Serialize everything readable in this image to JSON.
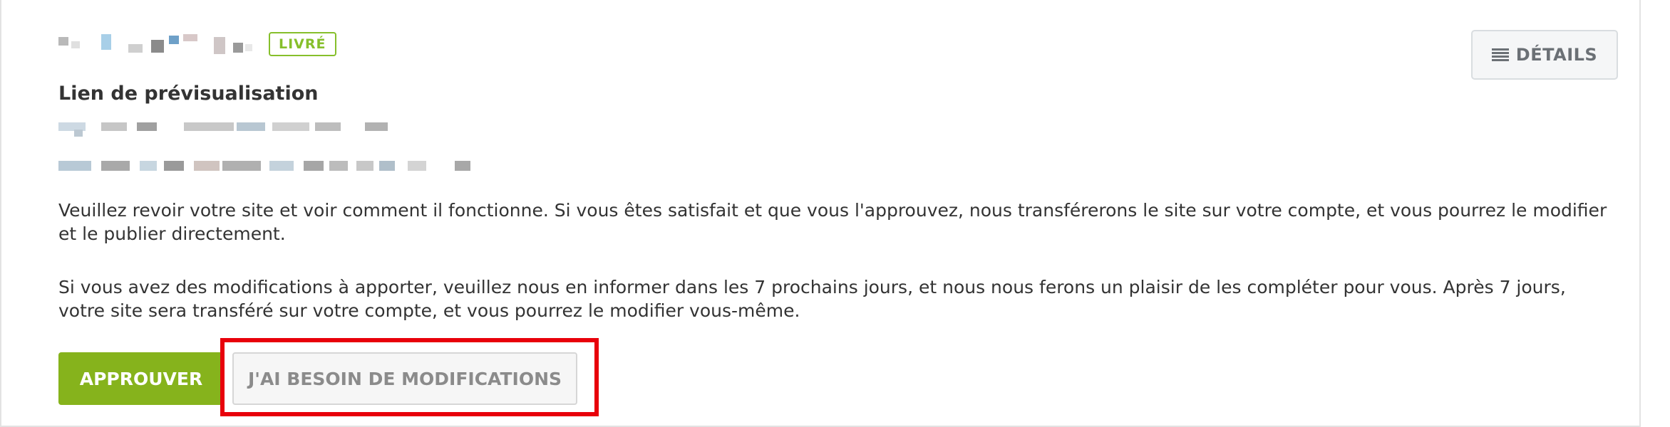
{
  "status_badge": "LIVRÉ",
  "details_button": {
    "label": "DÉTAILS",
    "icon": "list-icon"
  },
  "preview_section": {
    "label": "Lien de prévisualisation"
  },
  "paragraphs": [
    "Veuillez revoir votre site et voir comment il fonctionne. Si vous êtes satisfait et que vous l'approuvez, nous transférerons le site sur votre compte, et vous pourrez le modifier et le publier directement.",
    "Si vous avez des modifications à apporter, veuillez nous en informer dans les 7 prochains jours, et nous nous ferons un plaisir de les compléter pour vous. Après 7 jours, votre site sera transféré sur votre compte, et vous pourrez le modifier vous-même."
  ],
  "actions": {
    "approve_label": "APPROUVER",
    "modify_label": "J'AI BESOIN DE MODIFICATIONS"
  },
  "colors": {
    "accent_green": "#86b31c",
    "badge_green": "#86bf2b",
    "highlight_red": "#e8000b"
  }
}
